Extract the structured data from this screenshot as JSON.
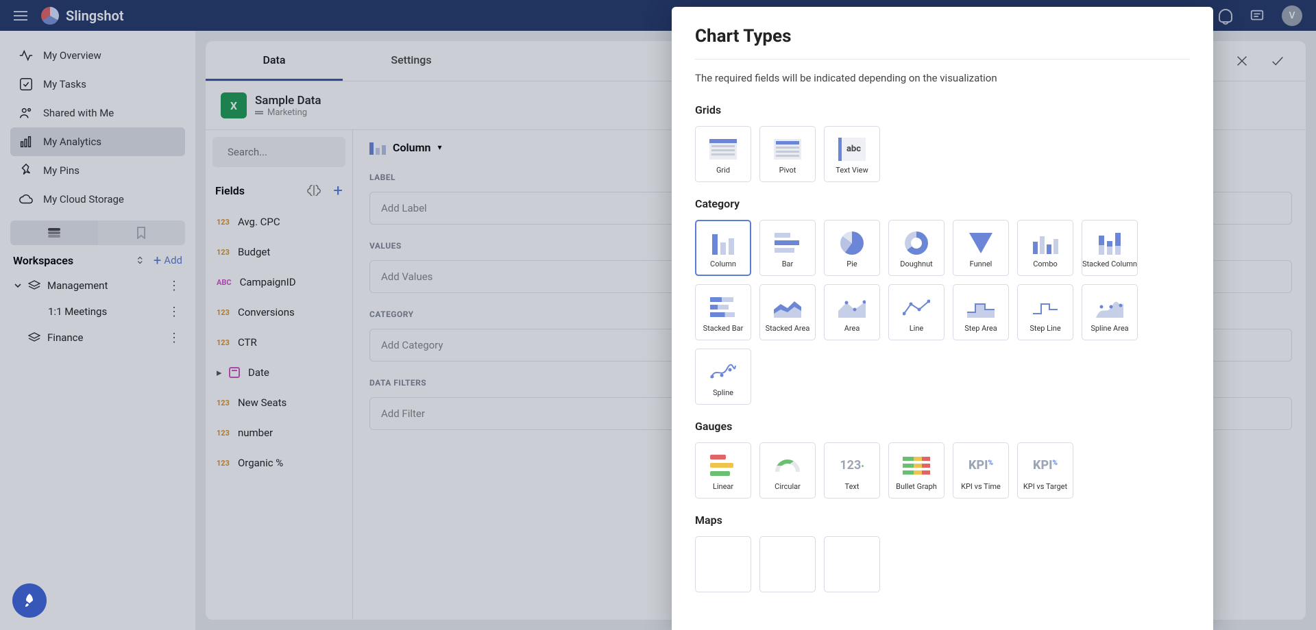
{
  "brand": "Slingshot",
  "avatar_initial": "V",
  "notification_badge": "!",
  "sidebar": {
    "items": [
      {
        "label": "My Overview"
      },
      {
        "label": "My Tasks"
      },
      {
        "label": "Shared with Me"
      },
      {
        "label": "My Analytics"
      },
      {
        "label": "My Pins"
      },
      {
        "label": "My Cloud Storage"
      }
    ],
    "workspaces_title": "Workspaces",
    "add_label": "Add",
    "tree": {
      "item1": "Management",
      "item1_child": "1:1 Meetings",
      "item2": "Finance"
    }
  },
  "tabs": {
    "data": "Data",
    "settings": "Settings"
  },
  "datasource": {
    "title": "Sample Data",
    "subtitle": "Marketing"
  },
  "search_placeholder": "Search...",
  "fields_title": "Fields",
  "fields": [
    {
      "type": "num",
      "label": "Avg. CPC"
    },
    {
      "type": "num",
      "label": "Budget"
    },
    {
      "type": "abc",
      "label": "CampaignID"
    },
    {
      "type": "num",
      "label": "Conversions"
    },
    {
      "type": "num",
      "label": "CTR"
    },
    {
      "type": "date",
      "label": "Date"
    },
    {
      "type": "num",
      "label": "New Seats"
    },
    {
      "type": "num",
      "label": "number"
    },
    {
      "type": "num",
      "label": "Organic %"
    }
  ],
  "chart_selector": {
    "label": "Column"
  },
  "slots": {
    "label_title": "LABEL",
    "label_ph": "Add Label",
    "values_title": "VALUES",
    "values_ph": "Add Values",
    "category_title": "CATEGORY",
    "category_ph": "Add Category",
    "filters_title": "DATA FILTERS",
    "filters_ph": "Add Filter"
  },
  "modal": {
    "title": "Chart Types",
    "subtitle": "The required fields will be indicated depending on the visualization",
    "groups": {
      "grids": "Grids",
      "category": "Category",
      "gauges": "Gauges",
      "maps": "Maps"
    },
    "charts": {
      "grid": "Grid",
      "pivot": "Pivot",
      "textview": "Text View",
      "column": "Column",
      "bar": "Bar",
      "pie": "Pie",
      "doughnut": "Doughnut",
      "funnel": "Funnel",
      "combo": "Combo",
      "stackedcol": "Stacked Column",
      "stackedbar": "Stacked Bar",
      "stackedarea": "Stacked Area",
      "area": "Area",
      "line": "Line",
      "steparea": "Step Area",
      "stepline": "Step Line",
      "splinearea": "Spline Area",
      "spline": "Spline",
      "linear": "Linear",
      "circular": "Circular",
      "text": "Text",
      "bullet": "Bullet Graph",
      "kpitime": "KPI vs Time",
      "kpitarget": "KPI vs Target"
    }
  }
}
